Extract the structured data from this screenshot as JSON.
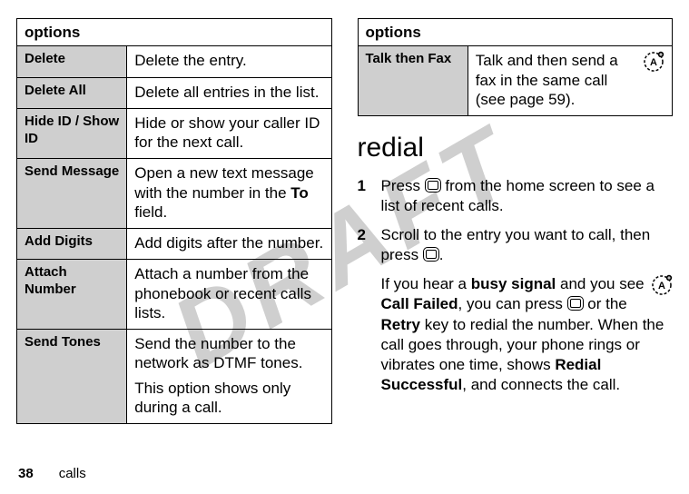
{
  "watermark": "DRAFT",
  "left_table": {
    "header": "options",
    "rows": [
      {
        "opt": "Delete",
        "desc": "Delete the entry."
      },
      {
        "opt": "Delete All",
        "desc": "Delete all entries in the list."
      },
      {
        "opt": "Hide ID / Show ID",
        "desc": "Hide or show your caller ID for the next call."
      },
      {
        "opt": "Send Message",
        "desc_pre": "Open a new text message with the number in the ",
        "desc_bold": "To",
        "desc_post": " field."
      },
      {
        "opt": "Add Digits",
        "desc": "Add digits after the number."
      },
      {
        "opt": "Attach Number",
        "desc": "Attach a number from the phonebook or recent calls lists."
      },
      {
        "opt": "Send Tones",
        "desc": "Send the number to the network as DTMF tones.",
        "desc2": "This option shows only during a call."
      }
    ]
  },
  "right_table": {
    "header": "options",
    "rows": [
      {
        "opt": "Talk then Fax",
        "desc": "Talk and then send a fax in the same call (see page 59)."
      }
    ]
  },
  "section_title": "redial",
  "steps": [
    {
      "n": "1",
      "pre": "Press ",
      "post": " from the home screen to see a list of recent calls."
    },
    {
      "n": "2",
      "pre": "Scroll to the entry you want to call, then press ",
      "post": "."
    }
  ],
  "para": {
    "t1": "If you hear a ",
    "busy": "busy signal",
    "t2": " and you see ",
    "cf": "Call Failed",
    "t3": ", you can press ",
    "t4": " or the ",
    "retry": "Retry",
    "t5": " key to redial the number. When the call goes through, your phone rings or vibrates one time, shows ",
    "rs": "Redial Successful",
    "t6": ", and connects the call."
  },
  "footer": {
    "page": "38",
    "section": "calls"
  }
}
